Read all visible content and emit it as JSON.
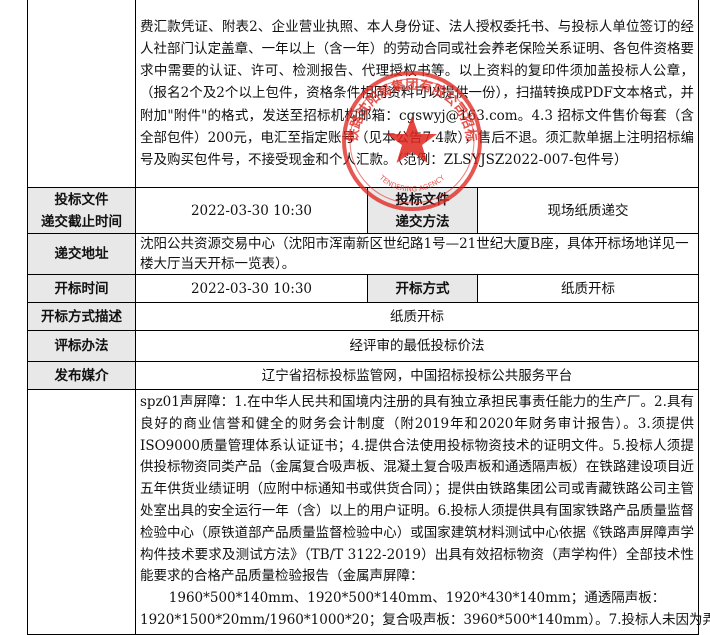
{
  "rows": {
    "top_text": "费汇款凭证、附表2、企业营业执照、本人身份证、法人授权委托书、与投标人单位签订的经人社部门认定盖章、一年以上（含一年）的劳动合同或社会养老保险关系证明、各包件资格要求中需要的认证、许可、检测报告、代理授权书等。以上资料的复印件须加盖投标人公章，（报名2个及2个以上包件，资格条件相同资料可以提供一份），扫描转换成PDF文本格式，并附加\"附件\"的格式，发送至招标机构邮箱：cgswyj@163.com。4.3 招标文件售价每套（含全部包件）200元，电汇至指定账号（见本公告7.4款），售后不退。须汇款单据上注明招标编号及购买包件号，不接受现金和个人汇款。（范例：ZLSYJSZ2022-007-包件号）",
    "deadline_label_1": "投标文件",
    "deadline_label_2": "递交截止时间",
    "deadline_value": "2022-03-30 10:30",
    "method_label_1": "投标文件",
    "method_label_2": "递交方法",
    "method_value": "现场纸质递交",
    "address_label": "递交地址",
    "address_value": "沈阳公共资源交易中心（沈阳市浑南新区世纪路1号—21世纪大厦B座，具体开标场地详见一楼大厅当天开标一览表）。",
    "open_time_label": "开标时间",
    "open_time_value": "2022-03-30 10:30",
    "open_form_label": "开标方式",
    "open_form_value": "纸质开标",
    "open_desc_label": "开标方式描述",
    "open_desc_value": "纸质开标",
    "eval_label": "评标办法",
    "eval_value": "经评审的最低投标价法",
    "media_label": "发布媒介",
    "media_value": "辽宁省招标投标监管网，中国招标投标公共服务平台",
    "bottom_text": "spz01声屏障：1.在中华人民共和国境内注册的具有独立承担民事责任能力的生产厂。2.具有良好的商业信誉和健全的财务会计制度（附2019年和2020年财务审计报告）。3.须提供ISO9000质量管理体系认证证书；4.提供合法使用投标物资技术的证明文件。5.投标人须提供投标物资同类产品（金属复合吸声板、混凝土复合吸声板和通透隔声板）在铁路建设项目近五年供货业绩证明（应附中标通知书或供货合同）；提供由铁路集团公司或青藏铁路公司主管处室出具的安全运行一年（含）以上的用户证明。6.投标人须提供具有国家铁路产品质量监督检验中心（原铁道部产品质量监督检验中心）或国家建筑材料测试中心依据《铁路声屏障声学构件技术要求及测试方法》（TB/T 3122-2019）出具有效招标物资（声学构件）全部技术性能要求的合格产品质量检验报告（金属声屏障：",
    "bottom_line2": "1960*500*140mm、1920*500*140mm、1920*430*140mm；通透隔声板：",
    "bottom_line3": "1920*1500*20mm/1960*1000*20；复合吸声板：3960*500*140mm）。7.投标人未因为弄虚"
  },
  "stamp": {
    "color": "#e0261f",
    "text": "中国铁路沈阳局集团有限公司招标代理",
    "bottom_text": "TENDERING AGENCY"
  }
}
